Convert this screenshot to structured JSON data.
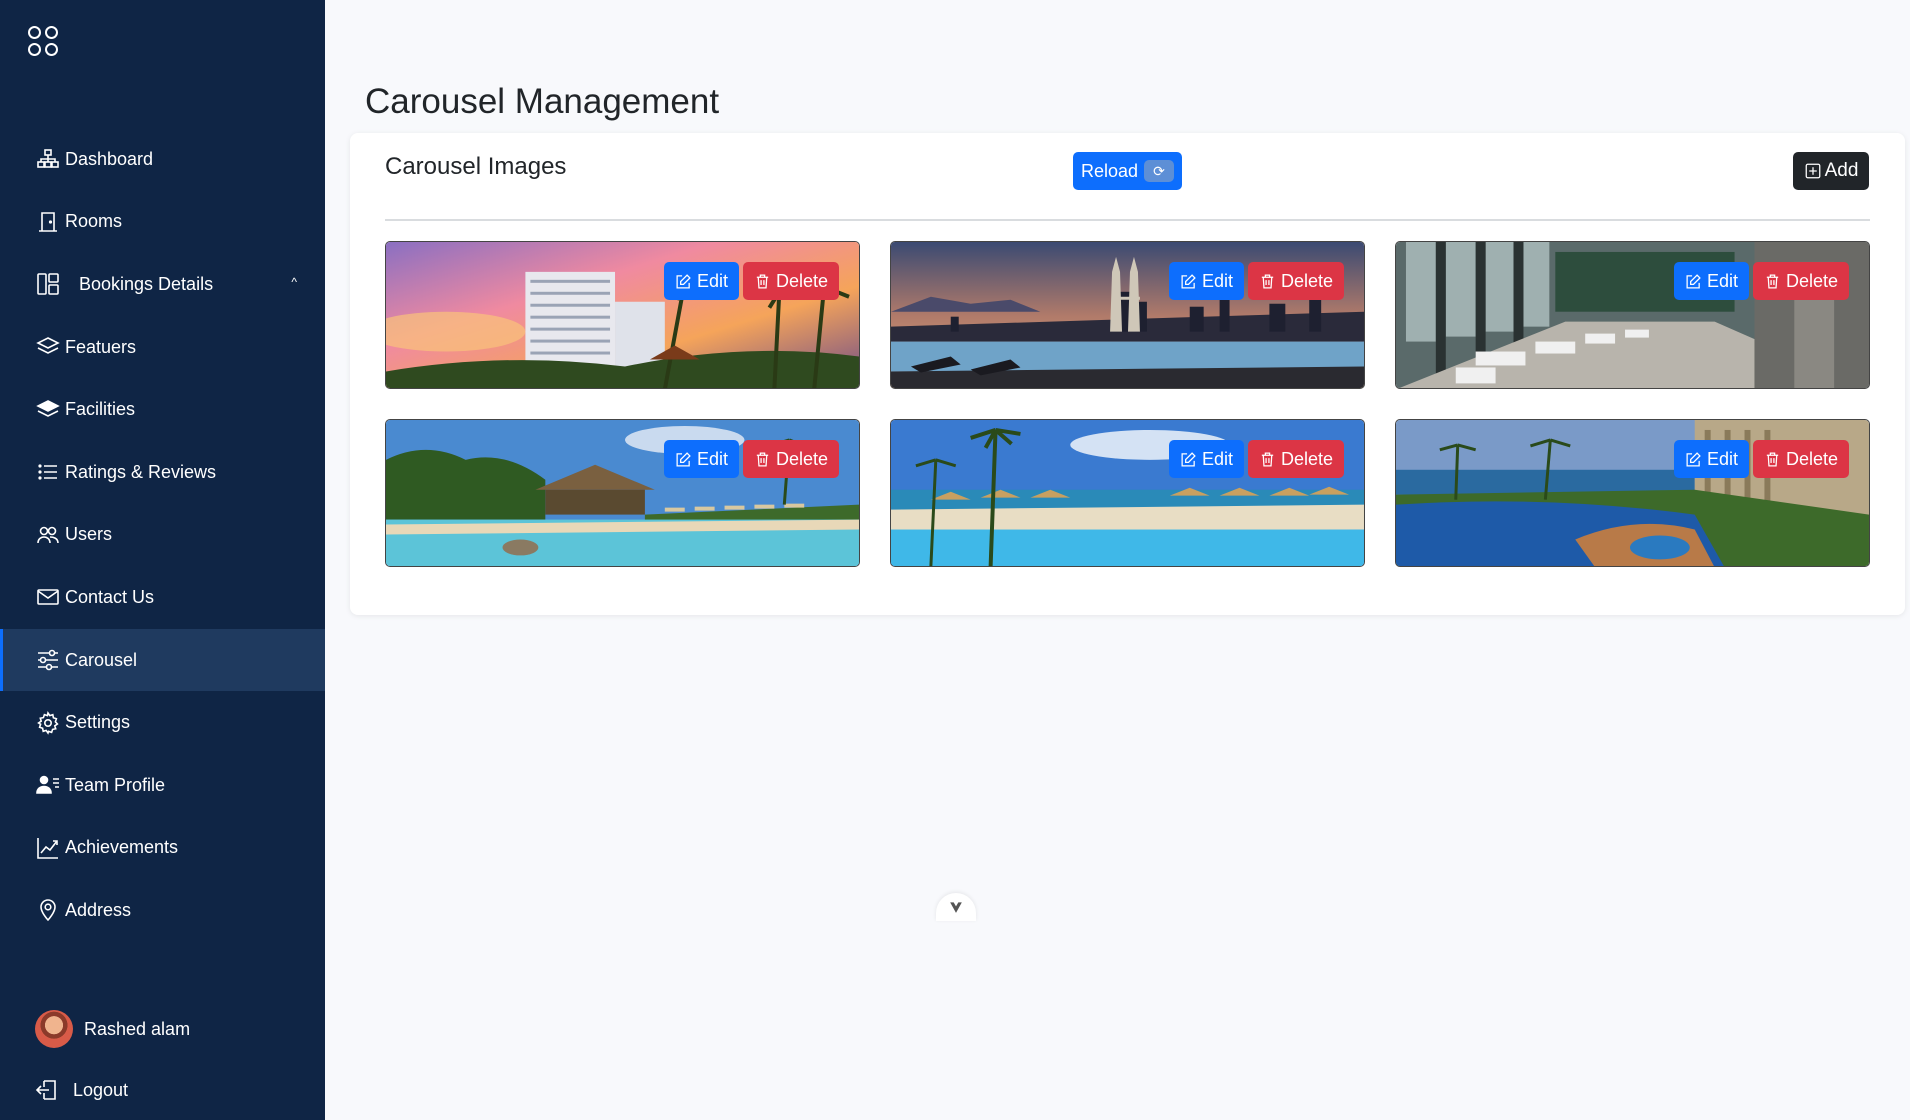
{
  "sidebar": {
    "logo_icon": "grid-circles-icon",
    "items": [
      {
        "label": "Dashboard",
        "icon": "sitemap-icon"
      },
      {
        "label": "Rooms",
        "icon": "door-icon"
      },
      {
        "label": "Bookings Details",
        "icon": "layout-icon"
      },
      {
        "label": "Featuers",
        "icon": "layers-icon"
      },
      {
        "label": "Facilities",
        "icon": "layers-filled-icon"
      },
      {
        "label": "Ratings & Reviews",
        "icon": "list-icon"
      },
      {
        "label": "Users",
        "icon": "users-icon"
      },
      {
        "label": "Contact Us",
        "icon": "envelope-icon"
      },
      {
        "label": "Carousel",
        "icon": "sliders-icon"
      },
      {
        "label": "Settings",
        "icon": "gear-icon"
      },
      {
        "label": "Team Profile",
        "icon": "person-lines-icon"
      },
      {
        "label": "Achievements",
        "icon": "graph-up-icon"
      },
      {
        "label": "Address",
        "icon": "geo-pin-icon"
      }
    ],
    "bookings_chevron": "^",
    "user_name": "Rashed alam",
    "logout_label": "Logout"
  },
  "main": {
    "page_title": "Carousel Management",
    "card_title": "Carousel Images",
    "reload_label": "Reload",
    "add_label": "Add",
    "images": [
      {
        "scene": "hotel-sunset",
        "edit_label": "Edit",
        "delete_label": "Delete"
      },
      {
        "scene": "city-infinity-pool",
        "edit_label": "Edit",
        "delete_label": "Delete"
      },
      {
        "scene": "lounge-interior",
        "edit_label": "Edit",
        "delete_label": "Delete"
      },
      {
        "scene": "tropical-pool",
        "edit_label": "Edit",
        "delete_label": "Delete"
      },
      {
        "scene": "beach-resort-pool",
        "edit_label": "Edit",
        "delete_label": "Delete"
      },
      {
        "scene": "oceanfront-pool",
        "edit_label": "Edit",
        "delete_label": "Delete"
      }
    ]
  },
  "colors": {
    "sidebar_bg": "#0f2545",
    "primary": "#0d6efd",
    "danger": "#dc3545",
    "dark": "#212529"
  }
}
